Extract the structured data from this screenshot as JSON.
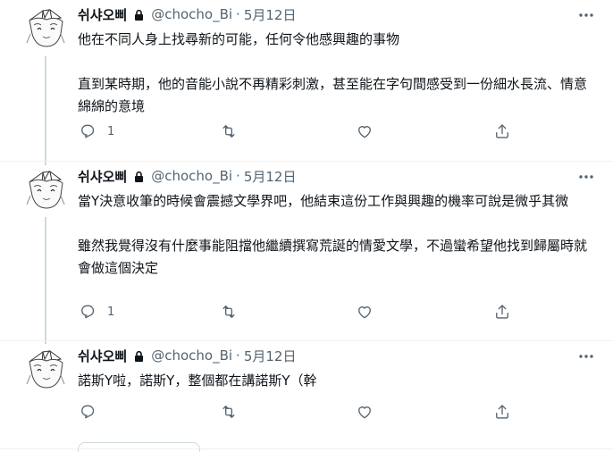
{
  "tweets": [
    {
      "author_name": "쉬샤오삐",
      "author_handle": "@chocho_Bi",
      "separator": "·",
      "date": "5月12日",
      "paragraphs": [
        "他在不同人身上找尋新的可能，任何令他感興趣的事物",
        "直到某時期，他的音能小說不再精彩刺激，甚至能在字句間感受到一份細水長流、情意綿綿的意境"
      ],
      "reply_count": "1",
      "retweet_count": "",
      "like_count": ""
    },
    {
      "author_name": "쉬샤오삐",
      "author_handle": "@chocho_Bi",
      "separator": "·",
      "date": "5月12日",
      "paragraphs": [
        "當Y決意收筆的時候會震撼文學界吧，他結束這份工作與興趣的機率可說是微乎其微",
        "雖然我覺得沒有什麼事能阻擋他繼續撰寫荒誕的情愛文學，不過蠻希望他找到歸屬時就會做這個決定"
      ],
      "reply_count": "1",
      "retweet_count": "",
      "like_count": ""
    },
    {
      "author_name": "쉬샤오삐",
      "author_handle": "@chocho_Bi",
      "separator": "·",
      "date": "5月12日",
      "paragraphs": [
        "諾斯Y啦，諾斯Y，整個都在講諾斯Y（幹"
      ],
      "reply_count": "",
      "retweet_count": "",
      "like_count": ""
    }
  ],
  "icons": {
    "lock": "lock-icon",
    "more": "more-icon",
    "reply": "reply-icon",
    "retweet": "retweet-icon",
    "like": "like-icon",
    "share": "share-icon"
  },
  "colors": {
    "text_primary": "#0f1419",
    "text_secondary": "#536471",
    "divider": "#eff3f4"
  }
}
